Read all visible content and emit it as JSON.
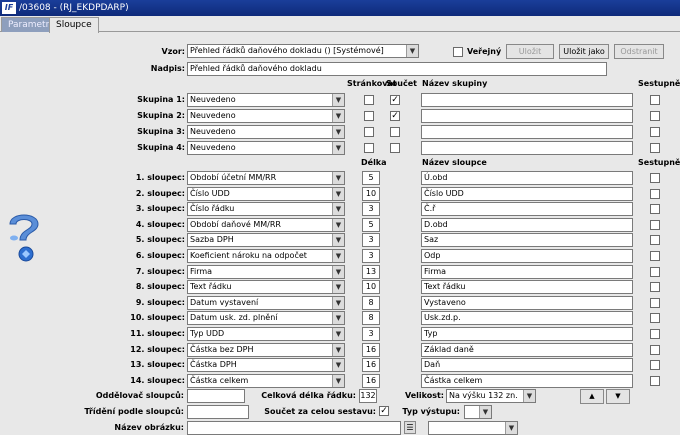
{
  "window": {
    "title": "/03608 - (RJ_EKDPDARP)"
  },
  "tabs": [
    {
      "label": "Parametry"
    },
    {
      "label": "Sloupce"
    }
  ],
  "top": {
    "vzor_label": "Vzor:",
    "vzor_value": "Přehled řádků daňového dokladu   ()   [Systémové]",
    "verejny_label": "Veřejný",
    "ulozit": "Uložit",
    "ulozit_jako": "Uložit jako",
    "odstranit": "Odstranit",
    "nadpis_label": "Nadpis:",
    "nadpis_value": "Přehled řádků daňového dokladu"
  },
  "group_headers": {
    "strankovat": "Stránkovat",
    "soucet": "Součet",
    "nazev_skupiny": "Název skupiny",
    "sestupne": "Sestupně"
  },
  "groups": [
    {
      "label": "Skupina 1:",
      "value": "Neuvedeno",
      "strankovat": "",
      "soucet": "✓"
    },
    {
      "label": "Skupina 2:",
      "value": "Neuvedeno",
      "strankovat": "",
      "soucet": "✓"
    },
    {
      "label": "Skupina 3:",
      "value": "Neuvedeno",
      "strankovat": "",
      "soucet": ""
    },
    {
      "label": "Skupina 4:",
      "value": "Neuvedeno",
      "strankovat": "",
      "soucet": ""
    }
  ],
  "column_headers": {
    "delka": "Délka",
    "nazev_sloupce": "Název sloupce",
    "sestupne": "Sestupně"
  },
  "columns": [
    {
      "label": "1. sloupec:",
      "value": "Období účetní MM/RR",
      "length": "5",
      "name": "Ú.obd"
    },
    {
      "label": "2. sloupec:",
      "value": "Číslo UDD",
      "length": "10",
      "name": "Číslo UDD"
    },
    {
      "label": "3. sloupec:",
      "value": "Číslo řádku",
      "length": "3",
      "name": "Č.ř"
    },
    {
      "label": "4. sloupec:",
      "value": "Období daňové MM/RR",
      "length": "5",
      "name": "D.obd"
    },
    {
      "label": "5. sloupec:",
      "value": "Sazba DPH",
      "length": "3",
      "name": "Saz"
    },
    {
      "label": "6. sloupec:",
      "value": "Koeficient nároku na odpočet",
      "length": "3",
      "name": "Odp"
    },
    {
      "label": "7. sloupec:",
      "value": "Firma",
      "length": "13",
      "name": "Firma"
    },
    {
      "label": "8. sloupec:",
      "value": "Text řádku",
      "length": "10",
      "name": "Text řádku"
    },
    {
      "label": "9. sloupec:",
      "value": "Datum vystavení",
      "length": "8",
      "name": "Vystaveno"
    },
    {
      "label": "10. sloupec:",
      "value": "Datum usk. zd. plnění",
      "length": "8",
      "name": "Usk.zd.p."
    },
    {
      "label": "11. sloupec:",
      "value": "Typ UDD",
      "length": "3",
      "name": "Typ"
    },
    {
      "label": "12. sloupec:",
      "value": "Částka bez DPH",
      "length": "16",
      "name": "Základ daně"
    },
    {
      "label": "13. sloupec:",
      "value": "Částka DPH",
      "length": "16",
      "name": "Daň"
    },
    {
      "label": "14. sloupec:",
      "value": "Částka celkem",
      "length": "16",
      "name": "Částka celkem"
    }
  ],
  "bottom": {
    "oddelovac_label": "Oddělovač sloupců:",
    "celkova_label": "Celková délka řádku:",
    "celkova_value": "132",
    "velikost_label": "Velikost:",
    "velikost_value": "Na výšku 132 zn.",
    "trideni_label": "Třídění podle sloupců:",
    "soucet_celou_label": "Součet za celou sestavu:",
    "soucet_celou_check": "✓",
    "typ_vystupu_label": "Typ výstupu:",
    "nazev_obrazku_label": "Název obrázku:",
    "up_arrow": "▲",
    "down_arrow": "▼"
  }
}
